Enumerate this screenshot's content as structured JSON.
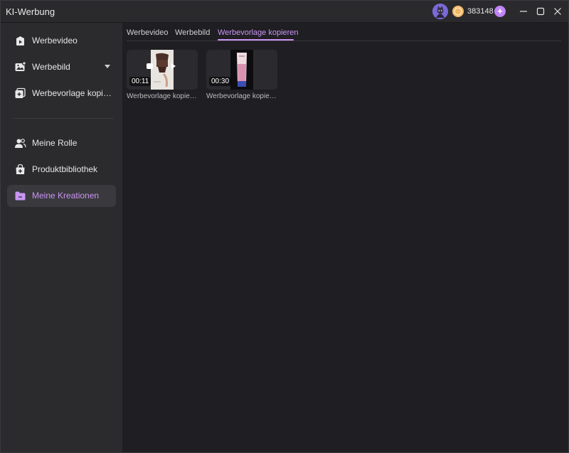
{
  "app": {
    "title": "KI-Werbung"
  },
  "header": {
    "coins": "383148",
    "plus_label": "+"
  },
  "sidebar": {
    "items": [
      {
        "label": "Werbevideo",
        "icon": "video-add-icon"
      },
      {
        "label": "Werbebild",
        "icon": "image-add-icon",
        "has_dropdown": true
      },
      {
        "label": "Werbevorlage kopieren",
        "icon": "copy-template-icon"
      },
      {
        "label": "Meine Rolle",
        "icon": "users-icon"
      },
      {
        "label": "Produktbibliothek",
        "icon": "bag-add-icon"
      },
      {
        "label": "Meine Kreationen",
        "icon": "folder-icon",
        "active": true
      }
    ]
  },
  "tabs": [
    {
      "label": "Werbevideo"
    },
    {
      "label": "Werbebild"
    },
    {
      "label": "Werbevorlage kopieren",
      "active": true
    }
  ],
  "creations": [
    {
      "title": "Werbevorlage kopieren",
      "duration": "00:11"
    },
    {
      "title": "Werbevorlage kopieren",
      "duration": "00:30"
    }
  ],
  "colors": {
    "accent": "#c995f3",
    "sidebar_bg": "#2b2b2e",
    "main_bg": "#1f1e23",
    "coin": "#f2b866"
  }
}
